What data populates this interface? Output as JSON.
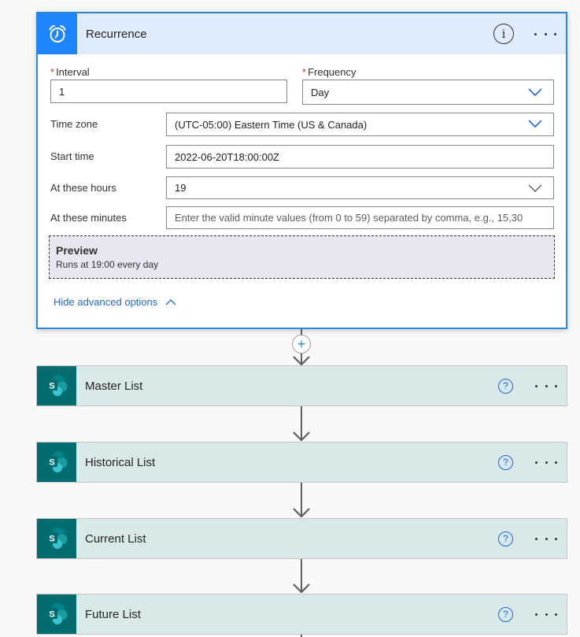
{
  "recurrence": {
    "title": "Recurrence",
    "icon": "alarm-clock-icon",
    "info_icon": "info-icon",
    "more_icon": "more-ellipsis-icon",
    "interval": {
      "label": "Interval",
      "required_mark": "*",
      "value": "1"
    },
    "frequency": {
      "label": "Frequency",
      "required_mark": "*",
      "value": "Day"
    },
    "time_zone": {
      "label": "Time zone",
      "value": "(UTC-05:00) Eastern Time (US & Canada)"
    },
    "start_time": {
      "label": "Start time",
      "value": "2022-06-20T18:00:00Z"
    },
    "at_these_hours": {
      "label": "At these hours",
      "value": "19"
    },
    "at_these_minutes": {
      "label": "At these minutes",
      "placeholder": "Enter the valid minute values (from 0 to 59) separated by comma, e.g., 15,30"
    },
    "preview": {
      "title": "Preview",
      "text": "Runs at 19:00 every day"
    },
    "hide_advanced_label": "Hide advanced options"
  },
  "connector": {
    "add_step_icon": "plus-icon",
    "add_step_symbol": "+"
  },
  "actions": [
    {
      "title": "Master List",
      "icon": "sharepoint-icon",
      "help_icon": "help-icon",
      "more_icon": "more-ellipsis-icon"
    },
    {
      "title": "Historical List",
      "icon": "sharepoint-icon",
      "help_icon": "help-icon",
      "more_icon": "more-ellipsis-icon"
    },
    {
      "title": "Current List",
      "icon": "sharepoint-icon",
      "help_icon": "help-icon",
      "more_icon": "more-ellipsis-icon"
    },
    {
      "title": "Future List",
      "icon": "sharepoint-icon",
      "help_icon": "help-icon",
      "more_icon": "more-ellipsis-icon"
    }
  ],
  "colors": {
    "recurrence_accent": "#1f85ff",
    "recurrence_header_bg": "#deecfd",
    "sharepoint_accent": "#036c70",
    "action_header_bg": "#d9e8e8",
    "link_blue": "#2266e3",
    "required_red": "#d13438"
  }
}
